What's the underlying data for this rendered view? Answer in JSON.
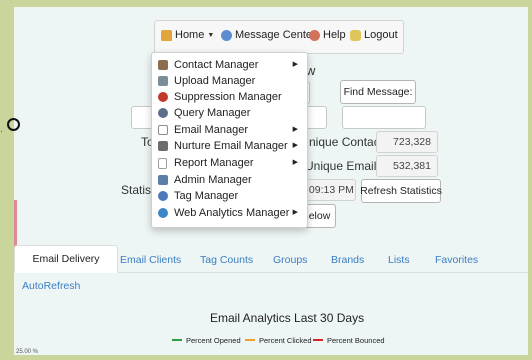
{
  "nav": {
    "home": {
      "label": "Home",
      "icon": "home-icon"
    },
    "message_center": {
      "label": "Message Center",
      "icon": "message-icon"
    },
    "help": {
      "label": "Help",
      "icon": "help-icon"
    },
    "logout": {
      "label": "Logout",
      "icon": "lock-icon"
    }
  },
  "dropdown": {
    "items": [
      {
        "label": "Contact Manager",
        "icon": "contact-manager-icon",
        "submenu": true,
        "color": "#8a6d4f"
      },
      {
        "label": "Upload Manager",
        "icon": "upload-manager-icon",
        "submenu": false,
        "color": "#7c8d9a"
      },
      {
        "label": "Suppression Manager",
        "icon": "suppression-manager-icon",
        "submenu": false,
        "color": "#c0392b"
      },
      {
        "label": "Query Manager",
        "icon": "query-manager-icon",
        "submenu": false,
        "color": "#5b6f8a"
      },
      {
        "label": "Email Manager",
        "icon": "email-manager-icon",
        "submenu": true,
        "color": "#8c8c8c"
      },
      {
        "label": "Nurture Email Manager",
        "icon": "nurture-email-icon",
        "submenu": true,
        "color": "#6d6d6d"
      },
      {
        "label": "Report Manager",
        "icon": "report-manager-icon",
        "submenu": true,
        "color": "#9e9e9e"
      },
      {
        "label": "Admin Manager",
        "icon": "admin-manager-icon",
        "submenu": false,
        "color": "#5a7ea8"
      },
      {
        "label": "Tag Manager",
        "icon": "tag-manager-icon",
        "submenu": false,
        "color": "#4c79b8"
      },
      {
        "label": "Web Analytics Manager",
        "icon": "web-analytics-icon",
        "submenu": true,
        "color": "#3d85c6"
      }
    ]
  },
  "page": {
    "title_partial": "w",
    "find_message_label": "Find Message:",
    "total_contacts_label_partial": "To",
    "unique_contacts_label": "nique Contacts:",
    "unique_contacts_value": "723,328",
    "unique_emails_label": "Unique Emails:",
    "unique_emails_value": "532,381",
    "statistics_label_partial": "Statist",
    "time_value": "9:09:13 PM",
    "refresh_statistics_label": "Refresh Statistics",
    "below_button_label": "Below"
  },
  "tabs": [
    {
      "label": "Email Delivery",
      "active": true
    },
    {
      "label": "Email Clients",
      "active": false
    },
    {
      "label": "Tag Counts",
      "active": false
    },
    {
      "label": "Groups",
      "active": false
    },
    {
      "label": "Brands",
      "active": false
    },
    {
      "label": "Lists",
      "active": false
    },
    {
      "label": "Favorites",
      "active": false
    },
    {
      "label": "AutoRefresh",
      "active": false
    }
  ],
  "chart": {
    "title": "Email Analytics Last 30 Days",
    "legend": [
      {
        "label": "Percent Opened",
        "color": "#2ea043"
      },
      {
        "label": "Percent Clicked",
        "color": "#f0a030"
      },
      {
        "label": "Percent Bounced",
        "color": "#d62728"
      }
    ],
    "axis_tick_partial": "25.00 %"
  },
  "colors": {
    "accent": "#3a7ec3",
    "frame": "#c9d59b",
    "background": "#eef5f5"
  }
}
